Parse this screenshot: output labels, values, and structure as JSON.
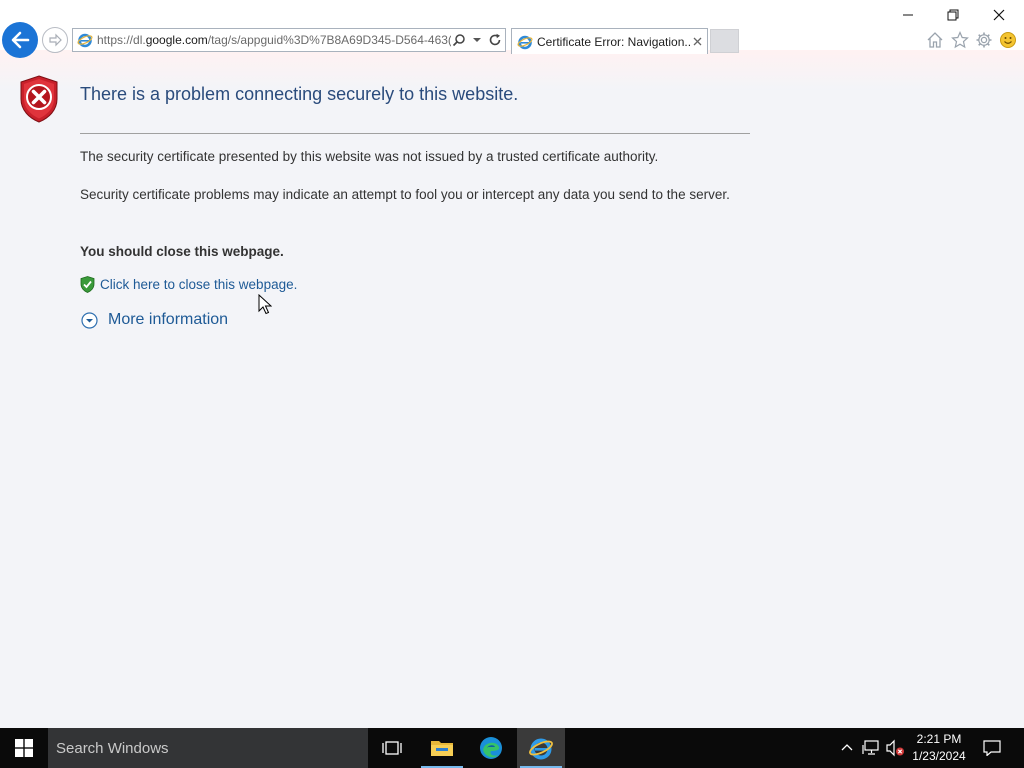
{
  "browser": {
    "address": {
      "url_prefix": "https://dl.",
      "url_domain": "google.com",
      "url_rest": "/tag/s/appguid%3D%7B8A69D345-D564-463("
    },
    "tab": {
      "title": "Certificate Error: Navigation..."
    }
  },
  "page": {
    "heading": "There is a problem connecting securely to this website.",
    "para1": "The security certificate presented by this website was not issued by a trusted certificate authority.",
    "para2": "Security certificate problems may indicate an attempt to fool you or intercept any data you send to the server.",
    "recommendation": "You should close this webpage.",
    "close_link": "Click here to close this webpage.",
    "more_info": "More information"
  },
  "taskbar": {
    "search_placeholder": "Search Windows",
    "time": "2:21 PM",
    "date": "1/23/2024"
  },
  "colors": {
    "accent_blue": "#1b74d6",
    "heading": "#2a4b7c",
    "link": "#1e5a96",
    "error_red": "#c8202a",
    "taskbar": "#0a0a0a"
  }
}
